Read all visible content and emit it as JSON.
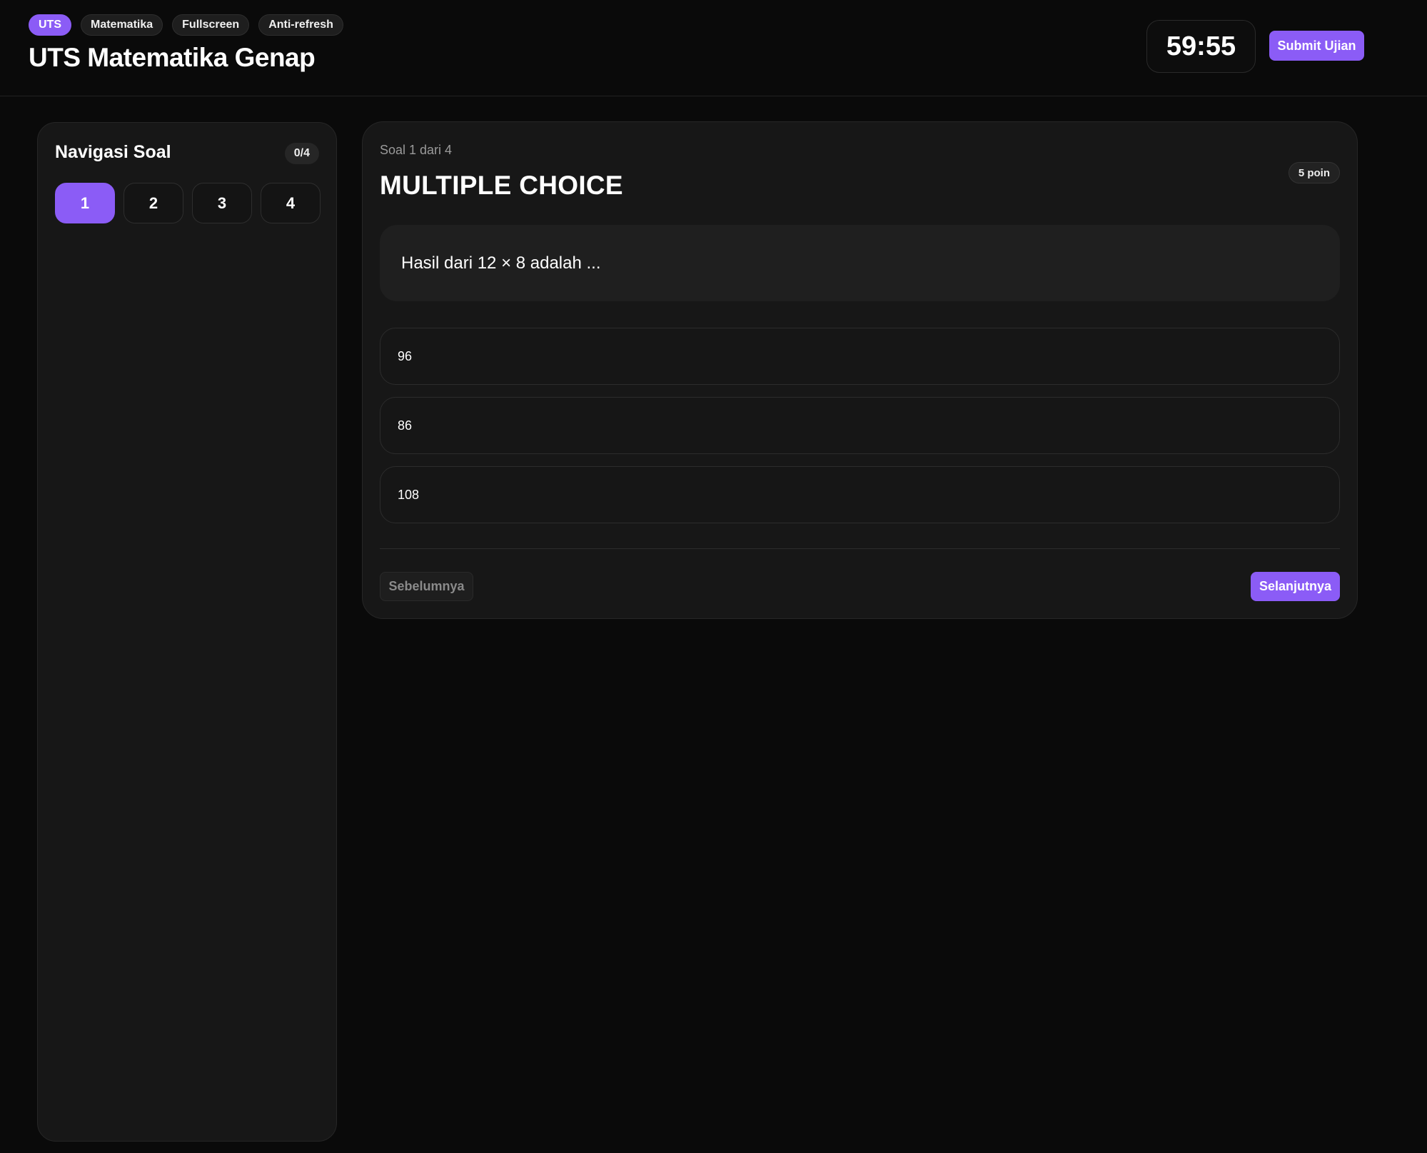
{
  "header": {
    "tags": [
      {
        "label": "UTS",
        "active": true
      },
      {
        "label": "Matematika",
        "active": false
      },
      {
        "label": "Fullscreen",
        "active": false
      },
      {
        "label": "Anti-refresh",
        "active": false
      }
    ],
    "title": "UTS Matematika Genap",
    "timer": "59:55",
    "submit_label": "Submit Ujian"
  },
  "sidebar": {
    "title": "Navigasi Soal",
    "progress": "0/4",
    "questions": [
      {
        "label": "1",
        "active": true
      },
      {
        "label": "2",
        "active": false
      },
      {
        "label": "3",
        "active": false
      },
      {
        "label": "4",
        "active": false
      }
    ]
  },
  "question": {
    "counter": "Soal 1 dari 4",
    "type": "MULTIPLE CHOICE",
    "points": "5 poin",
    "text": "Hasil dari 12 × 8 adalah ...",
    "options": [
      "96",
      "86",
      "108"
    ]
  },
  "nav": {
    "prev_label": "Sebelumnya",
    "next_label": "Selanjutnya"
  },
  "colors": {
    "accent": "#8b5cf6",
    "background": "#0a0a0a",
    "panel": "#171717"
  }
}
